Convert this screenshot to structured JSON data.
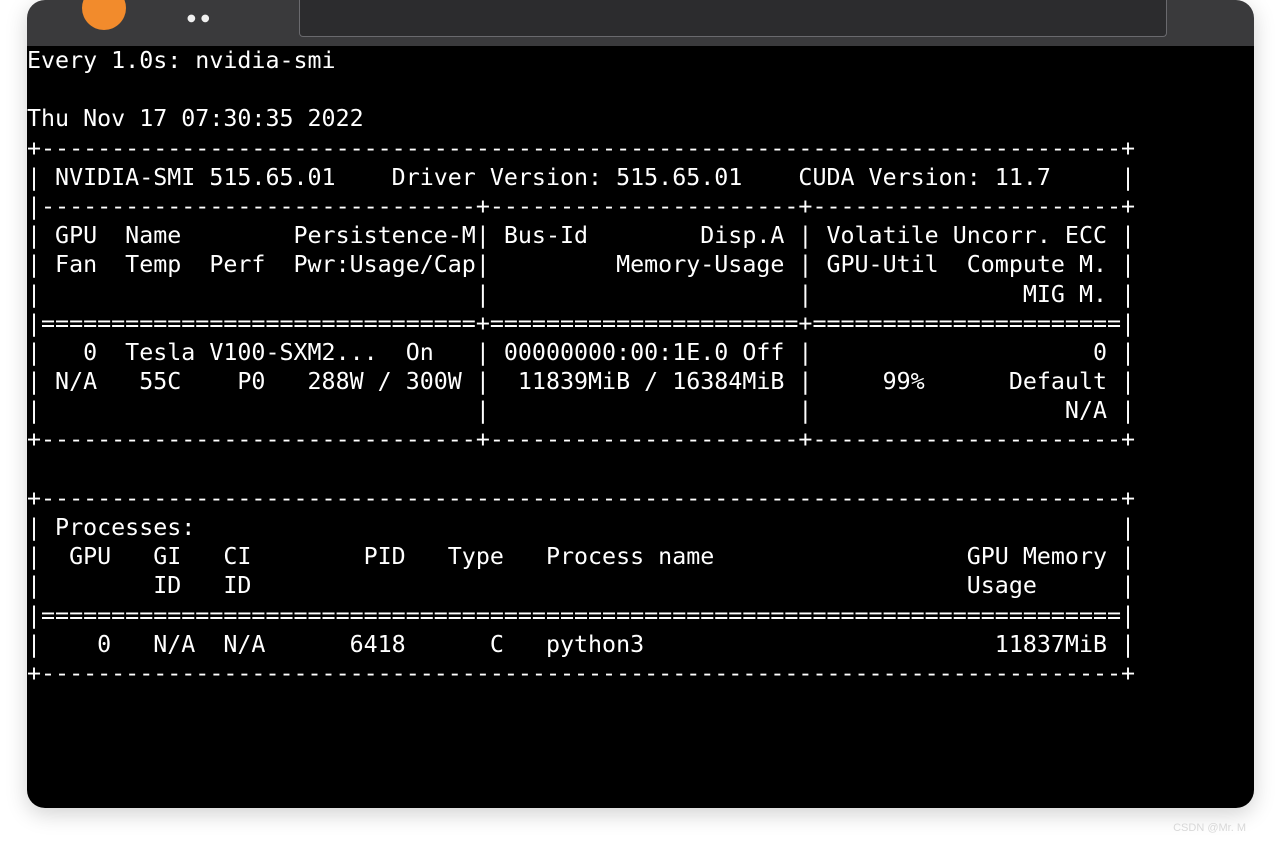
{
  "terminal": {
    "lines": [
      "Every 1.0s: nvidia-smi",
      "",
      "Thu Nov 17 07:30:35 2022",
      "+-----------------------------------------------------------------------------+",
      "| NVIDIA-SMI 515.65.01    Driver Version: 515.65.01    CUDA Version: 11.7     |",
      "|-------------------------------+----------------------+----------------------+",
      "| GPU  Name        Persistence-M| Bus-Id        Disp.A | Volatile Uncorr. ECC |",
      "| Fan  Temp  Perf  Pwr:Usage/Cap|         Memory-Usage | GPU-Util  Compute M. |",
      "|                               |                      |               MIG M. |",
      "|===============================+======================+======================|",
      "|   0  Tesla V100-SXM2...  On   | 00000000:00:1E.0 Off |                    0 |",
      "| N/A   55C    P0   288W / 300W |  11839MiB / 16384MiB |     99%      Default |",
      "|                               |                      |                  N/A |",
      "+-------------------------------+----------------------+----------------------+",
      "",
      "+-----------------------------------------------------------------------------+",
      "| Processes:                                                                  |",
      "|  GPU   GI   CI        PID   Type   Process name                  GPU Memory |",
      "|        ID   ID                                                   Usage      |",
      "|=============================================================================|",
      "|    0   N/A  N/A      6418      C   python3                         11837MiB |",
      "+-----------------------------------------------------------------------------+"
    ]
  },
  "watermark": "CSDN @Mr. M"
}
